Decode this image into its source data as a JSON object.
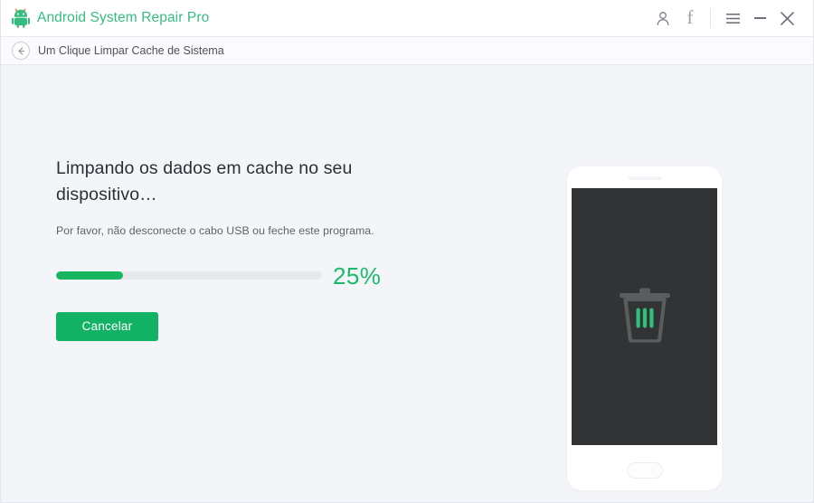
{
  "app": {
    "title": "Android System Repair Pro",
    "logo_icon": "android-robot-icon",
    "brand_color": "#35bd80"
  },
  "titlebar": {
    "account_icon": "person-icon",
    "facebook_icon": "facebook-f-icon",
    "facebook_glyph": "f",
    "menu_icon": "hamburger-menu-icon",
    "minimize_icon": "minimize-icon",
    "close_icon": "close-icon"
  },
  "breadcrumb": {
    "back_icon": "back-arrow-icon",
    "label": "Um Clique Limpar Cache de Sistema"
  },
  "main": {
    "headline": "Limpando os dados em cache no seu dispositivo…",
    "subtext": "Por favor, não desconecte o cabo USB ou feche este programa.",
    "progress": {
      "percent": 25,
      "percent_label": "25%",
      "fill_color": "#18b661",
      "track_color": "#e8e9ef",
      "text_color": "#1cb96a"
    },
    "cancel_label": "Cancelar",
    "cancel_color": "#12b264"
  },
  "illustration": {
    "device_icon": "smartphone-illustration",
    "screen_icon": "trash-can-icon",
    "screen_color": "#323335",
    "trash_body_color": "#5a5c5e",
    "trash_bar_color": "#2fc177"
  }
}
